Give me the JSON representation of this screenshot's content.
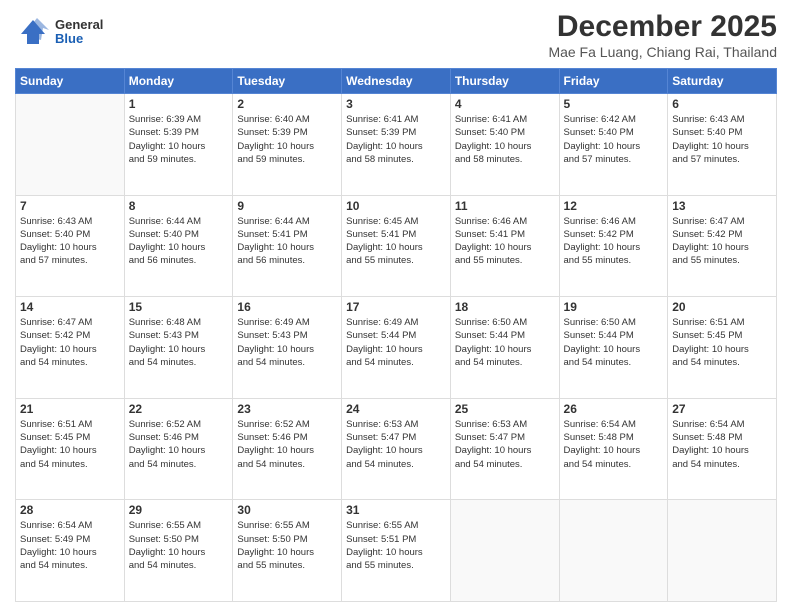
{
  "header": {
    "logo_general": "General",
    "logo_blue": "Blue",
    "month": "December 2025",
    "location": "Mae Fa Luang, Chiang Rai, Thailand"
  },
  "days_of_week": [
    "Sunday",
    "Monday",
    "Tuesday",
    "Wednesday",
    "Thursday",
    "Friday",
    "Saturday"
  ],
  "weeks": [
    [
      {
        "day": "",
        "empty": true
      },
      {
        "day": "1",
        "rise": "6:39 AM",
        "set": "5:39 PM",
        "daylight": "10 hours and 59 minutes."
      },
      {
        "day": "2",
        "rise": "6:40 AM",
        "set": "5:39 PM",
        "daylight": "10 hours and 59 minutes."
      },
      {
        "day": "3",
        "rise": "6:41 AM",
        "set": "5:39 PM",
        "daylight": "10 hours and 58 minutes."
      },
      {
        "day": "4",
        "rise": "6:41 AM",
        "set": "5:40 PM",
        "daylight": "10 hours and 58 minutes."
      },
      {
        "day": "5",
        "rise": "6:42 AM",
        "set": "5:40 PM",
        "daylight": "10 hours and 57 minutes."
      },
      {
        "day": "6",
        "rise": "6:43 AM",
        "set": "5:40 PM",
        "daylight": "10 hours and 57 minutes."
      }
    ],
    [
      {
        "day": "7",
        "rise": "6:43 AM",
        "set": "5:40 PM",
        "daylight": "10 hours and 57 minutes."
      },
      {
        "day": "8",
        "rise": "6:44 AM",
        "set": "5:40 PM",
        "daylight": "10 hours and 56 minutes."
      },
      {
        "day": "9",
        "rise": "6:44 AM",
        "set": "5:41 PM",
        "daylight": "10 hours and 56 minutes."
      },
      {
        "day": "10",
        "rise": "6:45 AM",
        "set": "5:41 PM",
        "daylight": "10 hours and 55 minutes."
      },
      {
        "day": "11",
        "rise": "6:46 AM",
        "set": "5:41 PM",
        "daylight": "10 hours and 55 minutes."
      },
      {
        "day": "12",
        "rise": "6:46 AM",
        "set": "5:42 PM",
        "daylight": "10 hours and 55 minutes."
      },
      {
        "day": "13",
        "rise": "6:47 AM",
        "set": "5:42 PM",
        "daylight": "10 hours and 55 minutes."
      }
    ],
    [
      {
        "day": "14",
        "rise": "6:47 AM",
        "set": "5:42 PM",
        "daylight": "10 hours and 54 minutes."
      },
      {
        "day": "15",
        "rise": "6:48 AM",
        "set": "5:43 PM",
        "daylight": "10 hours and 54 minutes."
      },
      {
        "day": "16",
        "rise": "6:49 AM",
        "set": "5:43 PM",
        "daylight": "10 hours and 54 minutes."
      },
      {
        "day": "17",
        "rise": "6:49 AM",
        "set": "5:44 PM",
        "daylight": "10 hours and 54 minutes."
      },
      {
        "day": "18",
        "rise": "6:50 AM",
        "set": "5:44 PM",
        "daylight": "10 hours and 54 minutes."
      },
      {
        "day": "19",
        "rise": "6:50 AM",
        "set": "5:44 PM",
        "daylight": "10 hours and 54 minutes."
      },
      {
        "day": "20",
        "rise": "6:51 AM",
        "set": "5:45 PM",
        "daylight": "10 hours and 54 minutes."
      }
    ],
    [
      {
        "day": "21",
        "rise": "6:51 AM",
        "set": "5:45 PM",
        "daylight": "10 hours and 54 minutes."
      },
      {
        "day": "22",
        "rise": "6:52 AM",
        "set": "5:46 PM",
        "daylight": "10 hours and 54 minutes."
      },
      {
        "day": "23",
        "rise": "6:52 AM",
        "set": "5:46 PM",
        "daylight": "10 hours and 54 minutes."
      },
      {
        "day": "24",
        "rise": "6:53 AM",
        "set": "5:47 PM",
        "daylight": "10 hours and 54 minutes."
      },
      {
        "day": "25",
        "rise": "6:53 AM",
        "set": "5:47 PM",
        "daylight": "10 hours and 54 minutes."
      },
      {
        "day": "26",
        "rise": "6:54 AM",
        "set": "5:48 PM",
        "daylight": "10 hours and 54 minutes."
      },
      {
        "day": "27",
        "rise": "6:54 AM",
        "set": "5:48 PM",
        "daylight": "10 hours and 54 minutes."
      }
    ],
    [
      {
        "day": "28",
        "rise": "6:54 AM",
        "set": "5:49 PM",
        "daylight": "10 hours and 54 minutes."
      },
      {
        "day": "29",
        "rise": "6:55 AM",
        "set": "5:50 PM",
        "daylight": "10 hours and 54 minutes."
      },
      {
        "day": "30",
        "rise": "6:55 AM",
        "set": "5:50 PM",
        "daylight": "10 hours and 55 minutes."
      },
      {
        "day": "31",
        "rise": "6:55 AM",
        "set": "5:51 PM",
        "daylight": "10 hours and 55 minutes."
      },
      {
        "day": "",
        "empty": true
      },
      {
        "day": "",
        "empty": true
      },
      {
        "day": "",
        "empty": true
      }
    ]
  ],
  "labels": {
    "sunrise": "Sunrise:",
    "sunset": "Sunset:",
    "daylight": "Daylight: "
  }
}
